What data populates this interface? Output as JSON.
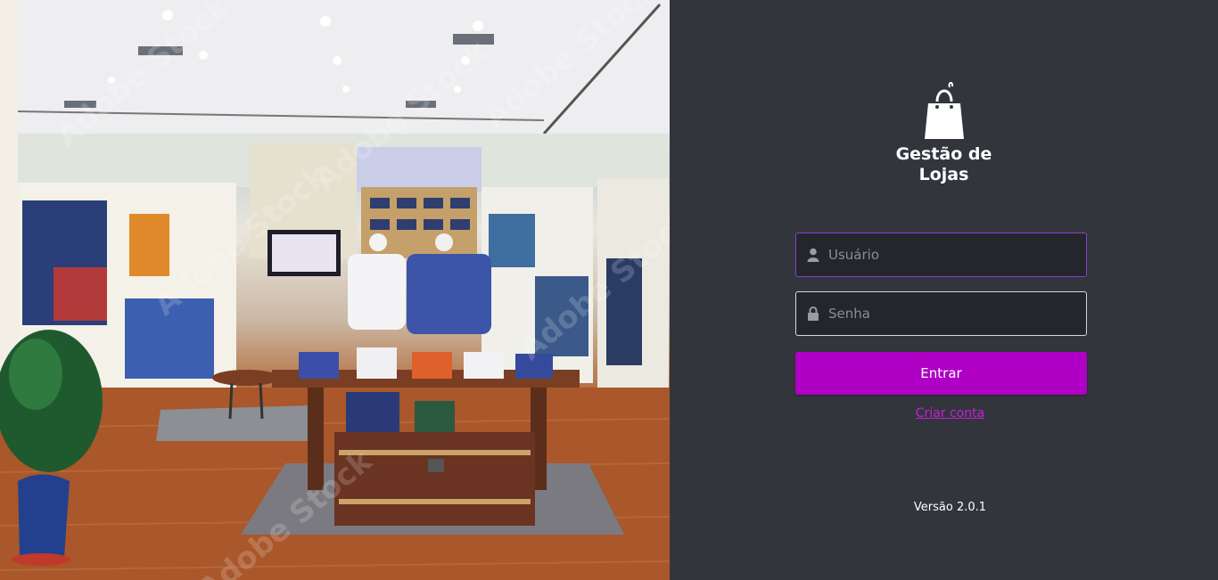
{
  "background": {
    "image_name": "clothing-store-interior-photo",
    "watermark": "Adobe Stock"
  },
  "login": {
    "brand": {
      "line1": "Gestão de",
      "line2": "Lojas",
      "icon": "shopping-bag-icon"
    },
    "username": {
      "placeholder": "Usuário",
      "value": "",
      "icon": "user-icon"
    },
    "password": {
      "placeholder": "Senha",
      "value": "",
      "icon": "lock-icon"
    },
    "submit_label": "Entrar",
    "create_account_label": "Criar conta",
    "version": "Versão 2.0.1"
  },
  "colors": {
    "panel_bg": "#33353d",
    "input_bg": "#24262b",
    "focus_border": "#8a3fd0",
    "accent": "#b000c6",
    "link": "#c51fd8"
  }
}
